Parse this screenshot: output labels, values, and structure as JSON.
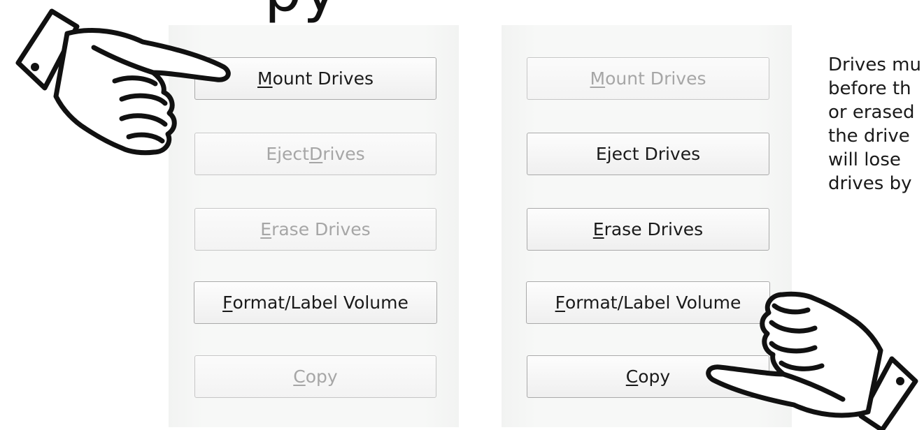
{
  "heading_fragment": "py",
  "left_panel": {
    "buttons": [
      {
        "pre": "",
        "mnemonic": "M",
        "post": "ount Drives",
        "state": "enabled"
      },
      {
        "pre": "Eject ",
        "mnemonic": "D",
        "post": "rives",
        "state": "disabled"
      },
      {
        "pre": "",
        "mnemonic": "E",
        "post": "rase Drives",
        "state": "disabled"
      },
      {
        "pre": "",
        "mnemonic": "F",
        "post": "ormat/Label Volume",
        "state": "enabled"
      },
      {
        "pre": "",
        "mnemonic": "C",
        "post": "opy",
        "state": "disabled"
      }
    ]
  },
  "right_panel": {
    "buttons": [
      {
        "pre": "",
        "mnemonic": "M",
        "post": "ount Drives",
        "state": "disabled"
      },
      {
        "pre": "Eject Drives",
        "mnemonic": "",
        "post": "",
        "state": "enabled"
      },
      {
        "pre": "",
        "mnemonic": "E",
        "post": "rase Drives",
        "state": "enabled"
      },
      {
        "pre": "",
        "mnemonic": "F",
        "post": "ormat/Label Volume",
        "state": "enabled"
      },
      {
        "pre": "",
        "mnemonic": "C",
        "post": "opy",
        "state": "enabled"
      }
    ]
  },
  "side_text": {
    "lines": [
      "Drives mu",
      "before th",
      "or erased",
      "the drive",
      "will lose",
      "drives by"
    ]
  },
  "icons": {
    "left_hand": "pointing-hand-right-icon",
    "right_hand": "pointing-hand-left-icon"
  },
  "colors": {
    "enabled_text": "#1a1a1a",
    "disabled_text": "#a6a6a6",
    "panel_bg": "#f7f8f7"
  }
}
